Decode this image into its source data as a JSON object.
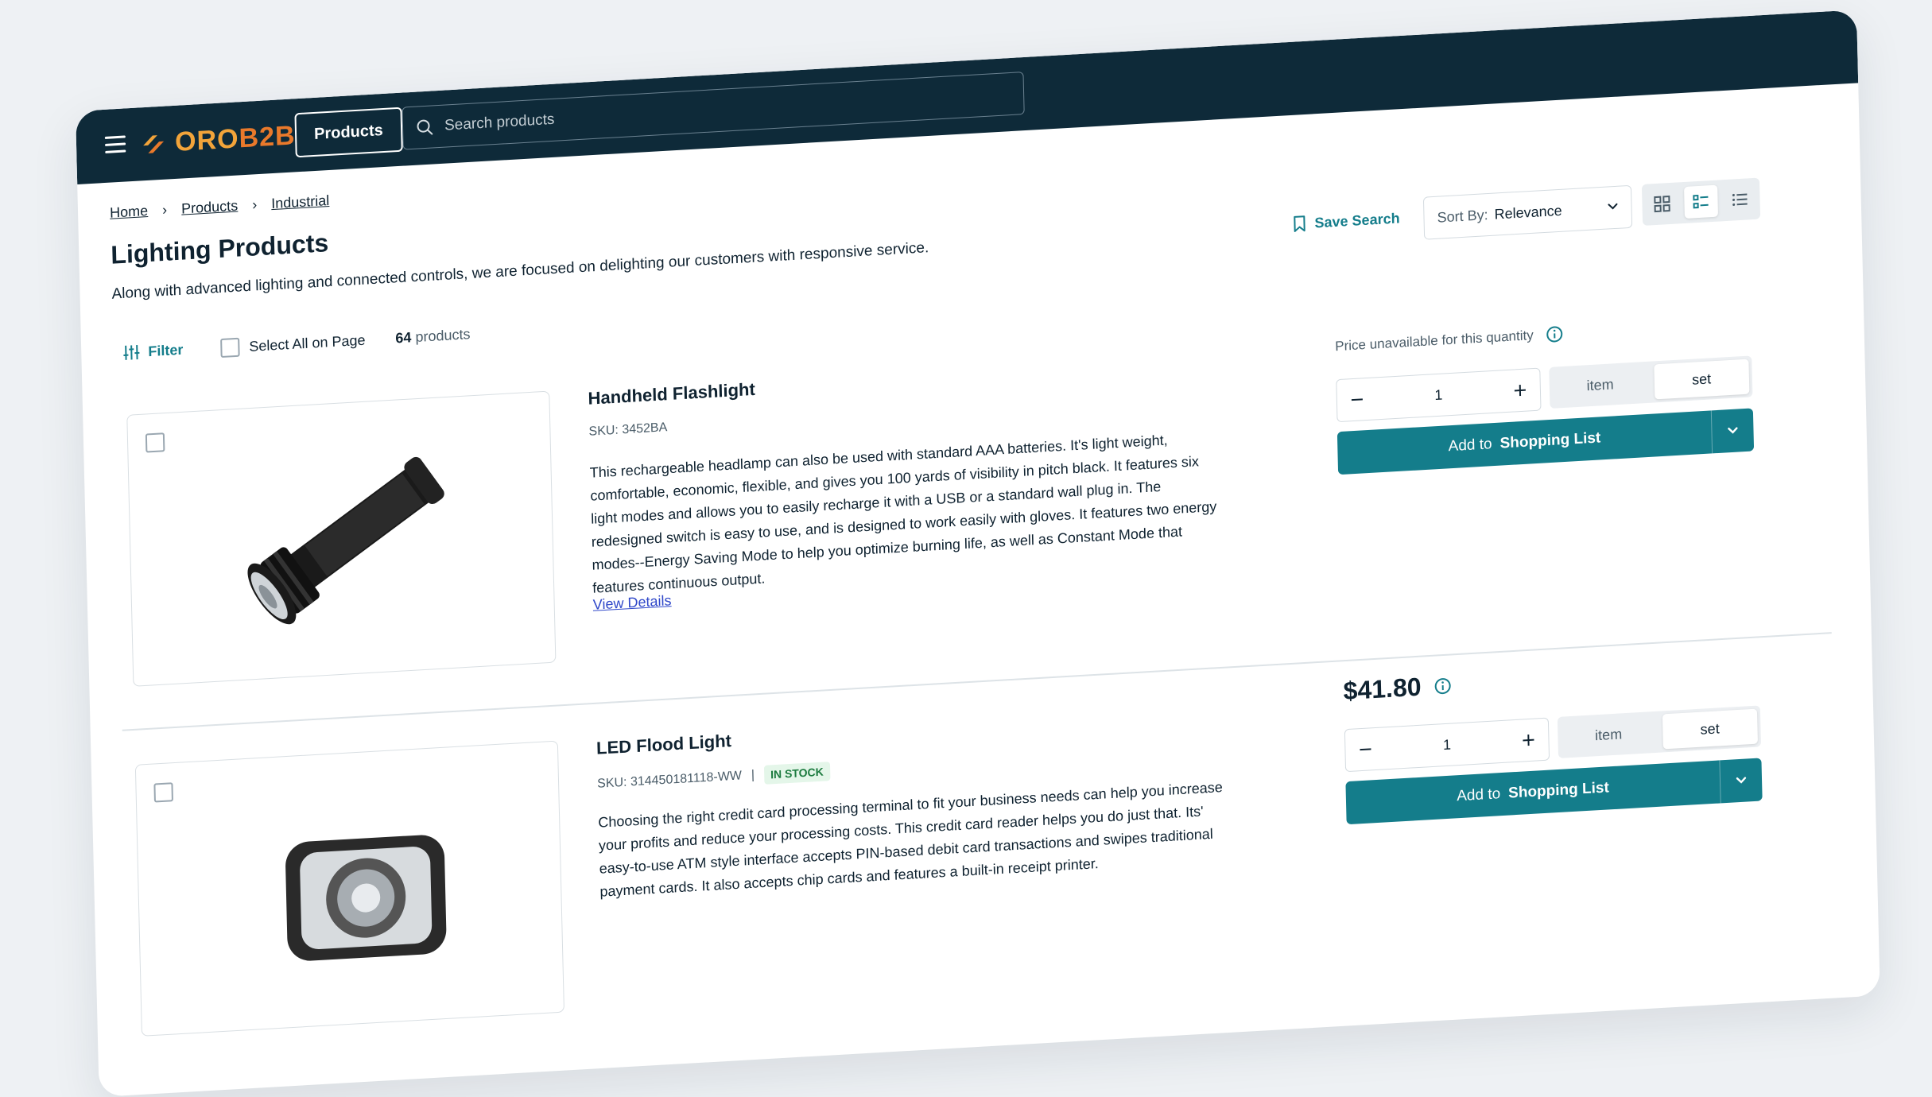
{
  "header": {
    "logo_text_1": "ORO",
    "logo_text_2": "B2B",
    "products_label": "Products",
    "search_placeholder": "Search products"
  },
  "breadcrumbs": [
    "Home",
    "Products",
    "Industrial"
  ],
  "page": {
    "title": "Lighting Products",
    "description": "Along with advanced lighting and connected controls, we are focused on delighting our customers with responsive service."
  },
  "toolbar": {
    "save_search": "Save Search",
    "sort_label": "Sort By:",
    "sort_value": "Relevance"
  },
  "filter": {
    "label": "Filter",
    "select_all": "Select All on Page",
    "count_value": "64",
    "count_suffix": "products"
  },
  "products": [
    {
      "name": "Handheld Flashlight",
      "sku_label": "SKU:",
      "sku": "3452BA",
      "description": "This rechargeable headlamp can also be used with standard AAA batteries. It's light weight, comfortable, economic, flexible, and gives you 100 yards of visibility in pitch black. It features six light modes and allows you to easily recharge it with a USB or a standard wall plug in. The redesigned switch is easy to use, and is designed to work easily with gloves. It features two energy modes--Energy Saving Mode to help you optimize burning life, as well as Constant Mode that features continuous output.",
      "view_details": "View Details",
      "price_note": "Price unavailable for this quantity",
      "quantity": "1",
      "units": [
        "item",
        "set"
      ],
      "selected_unit": "set",
      "add_label": "Add to",
      "add_target": "Shopping List"
    },
    {
      "name": "LED Flood Light",
      "sku_label": "SKU:",
      "sku": "314450181118-WW",
      "stock": "IN STOCK",
      "description": "Choosing the right credit card processing terminal to fit your business needs can help you increase your profits and reduce your processing costs. This credit card reader helps you do just that. Its' easy-to-use ATM style interface accepts PIN-based debit card transactions and swipes traditional payment cards. It also accepts chip cards and features a built-in receipt printer.",
      "price": "$41.80",
      "quantity": "1",
      "units": [
        "item",
        "set"
      ],
      "selected_unit": "set",
      "add_label": "Add to",
      "add_target": "Shopping List"
    }
  ],
  "colors": {
    "header_bg": "#0e2a39",
    "accent": "#147d8b",
    "logo_orange": "#f2a43a",
    "link_blue": "#2f47c9"
  }
}
